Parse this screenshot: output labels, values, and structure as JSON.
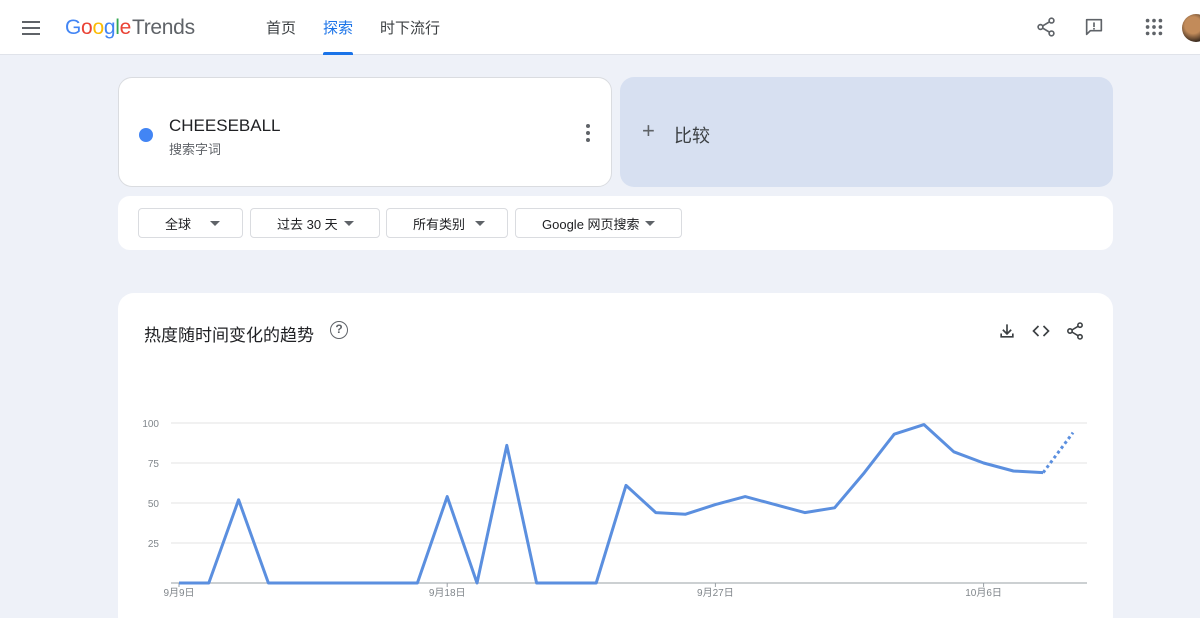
{
  "header": {
    "logo": {
      "google": [
        "G",
        "o",
        "o",
        "g",
        "l",
        "e"
      ],
      "google_colors": [
        "#4285f4",
        "#ea4335",
        "#fbbc05",
        "#4285f4",
        "#34a853",
        "#ea4335"
      ],
      "trends": "Trends"
    },
    "nav": [
      {
        "label": "首页",
        "active": false
      },
      {
        "label": "探索",
        "active": true
      },
      {
        "label": "时下流行",
        "active": false
      }
    ],
    "icons": [
      "menu-icon",
      "share-icon",
      "feedback-icon",
      "apps-icon",
      "avatar"
    ]
  },
  "search": {
    "term": "CHEESEBALL",
    "term_type": "搜索字词",
    "term_color": "#4285f4",
    "compare_label": "比较"
  },
  "filters": [
    {
      "label": "全球"
    },
    {
      "label": "过去 30 天"
    },
    {
      "label": "所有类别"
    },
    {
      "label": "Google 网页搜索"
    }
  ],
  "chart_section": {
    "title": "热度随时间变化的趋势",
    "icons": [
      "help-icon",
      "download-icon",
      "embed-icon",
      "share-icon"
    ]
  },
  "chart_data": {
    "type": "line",
    "title": "",
    "xlabel": "",
    "ylabel": "",
    "ylim": [
      0,
      100
    ],
    "yticks": [
      25,
      50,
      75,
      100
    ],
    "xticks": [
      "9月9日",
      "9月18日",
      "9月27日",
      "10月6日"
    ],
    "x": [
      "9月9日",
      "9月10日",
      "9月11日",
      "9月12日",
      "9月13日",
      "9月14日",
      "9月15日",
      "9月16日",
      "9月17日",
      "9月18日",
      "9月19日",
      "9月20日",
      "9月21日",
      "9月22日",
      "9月23日",
      "9月24日",
      "9月25日",
      "9月26日",
      "9月27日",
      "9月28日",
      "9月29日",
      "9月30日",
      "10月1日",
      "10月2日",
      "10月3日",
      "10月4日",
      "10月5日",
      "10月6日",
      "10月7日",
      "10月8日"
    ],
    "series": [
      {
        "name": "CHEESEBALL",
        "color": "#5b8fdf",
        "values": [
          0,
          0,
          52,
          0,
          0,
          0,
          0,
          0,
          0,
          54,
          0,
          86,
          0,
          0,
          0,
          61,
          44,
          43,
          49,
          54,
          49,
          44,
          47,
          69,
          93,
          99,
          82,
          75,
          70,
          69,
          94
        ],
        "partial_from_index": 29
      }
    ],
    "grid": true
  }
}
